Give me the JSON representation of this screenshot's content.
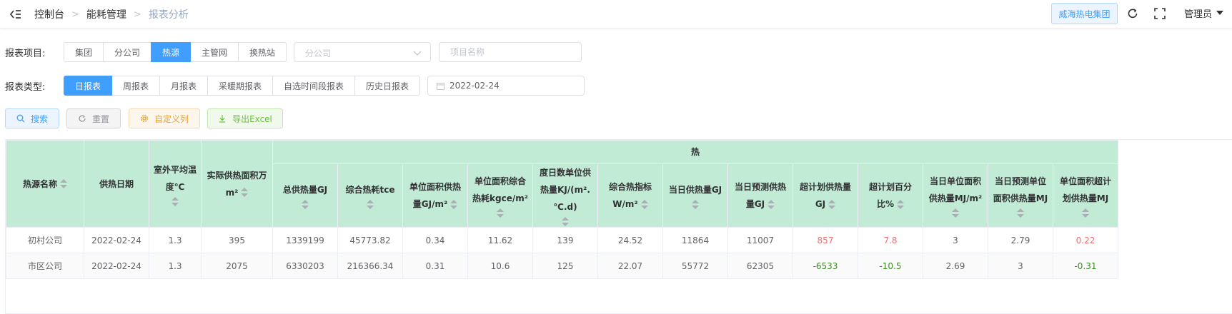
{
  "header": {
    "breadcrumb": [
      "控制台",
      "能耗管理",
      "报表分析"
    ],
    "company": "威海热电集团",
    "user": "管理员"
  },
  "filters": {
    "project_label": "报表项目:",
    "project_options": [
      "集团",
      "分公司",
      "热源",
      "主管网",
      "换热站"
    ],
    "project_active": "热源",
    "branch_placeholder": "分公司",
    "name_placeholder": "项目名称",
    "type_label": "报表类型:",
    "type_options": [
      "日报表",
      "周报表",
      "月报表",
      "采暖期报表",
      "自选时间段报表",
      "历史日报表"
    ],
    "type_active": "日报表",
    "date_value": "2022-02-24"
  },
  "actions": {
    "search": "搜索",
    "reset": "重置",
    "custom_columns": "自定义列",
    "export": "导出Excel"
  },
  "table": {
    "group_header": "热",
    "columns": [
      {
        "key": "name",
        "label": "热源名称",
        "sortable": true
      },
      {
        "key": "date",
        "label": "供热日期",
        "sortable": false
      },
      {
        "key": "temp",
        "label": "室外平均温度℃",
        "sortable": true
      },
      {
        "key": "area",
        "label": "实际供热面积万m²",
        "sortable": true
      },
      {
        "key": "total_gj",
        "label": "总供热量GJ",
        "sortable": true
      },
      {
        "key": "tce",
        "label": "综合热耗tce",
        "sortable": true
      },
      {
        "key": "unit_gj",
        "label": "单位面积供热量GJ/m²",
        "sortable": true
      },
      {
        "key": "unit_kgce",
        "label": "单位面积综合热耗kgce/m²",
        "sortable": true
      },
      {
        "key": "degree_day",
        "label": "度日数单位供热量KJ/(m².℃.d)",
        "sortable": true
      },
      {
        "key": "w_index",
        "label": "综合热指标W/m²",
        "sortable": true
      },
      {
        "key": "day_gj",
        "label": "当日供热量GJ",
        "sortable": true
      },
      {
        "key": "day_forecast",
        "label": "当日预测供热量GJ",
        "sortable": true
      },
      {
        "key": "over_gj",
        "label": "超计划供热量GJ",
        "sortable": true
      },
      {
        "key": "over_pct",
        "label": "超计划百分比%",
        "sortable": true
      },
      {
        "key": "day_unit_mj",
        "label": "当日单位面积供热量MJ/m²",
        "sortable": true
      },
      {
        "key": "forecast_unit_mj",
        "label": "当日预测单位面积供热量MJ",
        "sortable": true
      },
      {
        "key": "over_unit_mj",
        "label": "单位面积超计划供热量MJ",
        "sortable": true
      }
    ],
    "rows": [
      {
        "name": "初村公司",
        "date": "2022-02-24",
        "temp": "1.3",
        "area": "395",
        "total_gj": "1339199",
        "tce": "45773.82",
        "unit_gj": "0.34",
        "unit_kgce": "11.62",
        "degree_day": "139",
        "w_index": "24.52",
        "day_gj": "11864",
        "day_forecast": "11007",
        "over_gj": "857",
        "over_pct": "7.8",
        "day_unit_mj": "3",
        "forecast_unit_mj": "2.79",
        "over_unit_mj": "0.22"
      },
      {
        "name": "市区公司",
        "date": "2022-02-24",
        "temp": "1.3",
        "area": "2075",
        "total_gj": "6330203",
        "tce": "216366.34",
        "unit_gj": "0.31",
        "unit_kgce": "10.6",
        "degree_day": "125",
        "w_index": "22.07",
        "day_gj": "55772",
        "day_forecast": "62305",
        "over_gj": "-6533",
        "over_pct": "-10.5",
        "day_unit_mj": "2.69",
        "forecast_unit_mj": "3",
        "over_unit_mj": "-0.31"
      }
    ],
    "colors": {
      "header_bg": "#c2ebd5",
      "positive": "#f56c6c",
      "negative": "#3a8e1f"
    }
  }
}
